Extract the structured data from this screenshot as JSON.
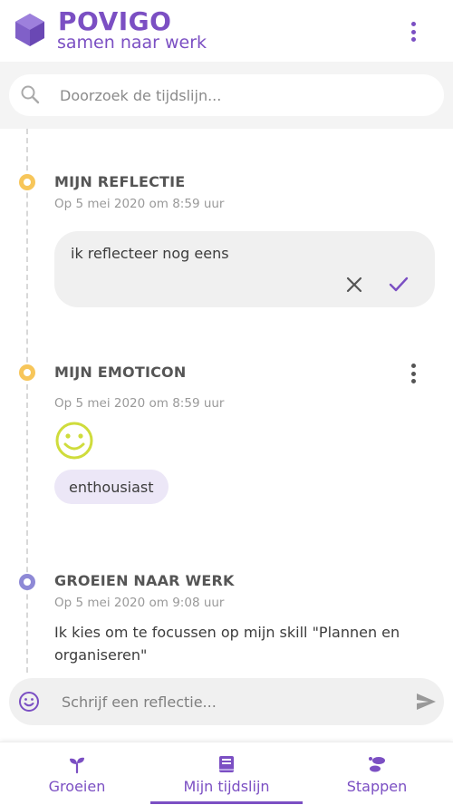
{
  "header": {
    "brand": "POVIGO",
    "tagline": "samen naar werk",
    "menu_icon": "more-vertical-icon",
    "accent_color": "#7b4fc3"
  },
  "search": {
    "placeholder": "Doorzoek de tijdslijn...",
    "value": "",
    "icon": "search-icon"
  },
  "timeline": {
    "items": [
      {
        "title": "MIJN REFLECTIE",
        "date": "Op 5 mei 2020 om 8:59 uur",
        "dot_color": "#f7c65a",
        "text": "ik reflecteer nog eens",
        "actions": [
          "close-icon",
          "check-icon"
        ]
      },
      {
        "title": "MIJN EMOTICON",
        "date": "Op 5 mei 2020 om 8:59 uur",
        "dot_color": "#f7c65a",
        "emoticon": "smiley-icon",
        "tag": "enthousiast",
        "menu_icon": "more-vertical-icon"
      },
      {
        "title": "GROEIEN NAAR WERK",
        "date": "Op 5 mei 2020 om 9:08 uur",
        "dot_color": "#8e89d6",
        "text": "Ik kies om te focussen op mijn skill \"Plannen en organiseren\""
      }
    ]
  },
  "composer": {
    "placeholder": "Schrijf een reflectie...",
    "value": "",
    "emoji_icon": "emoji-icon",
    "send_icon": "send-icon"
  },
  "bottom_nav": {
    "items": [
      {
        "label": "Groeien",
        "icon": "sprout-icon",
        "active": false
      },
      {
        "label": "Mijn tijdslijn",
        "icon": "book-icon",
        "active": true
      },
      {
        "label": "Stappen",
        "icon": "footsteps-icon",
        "active": false
      }
    ]
  }
}
